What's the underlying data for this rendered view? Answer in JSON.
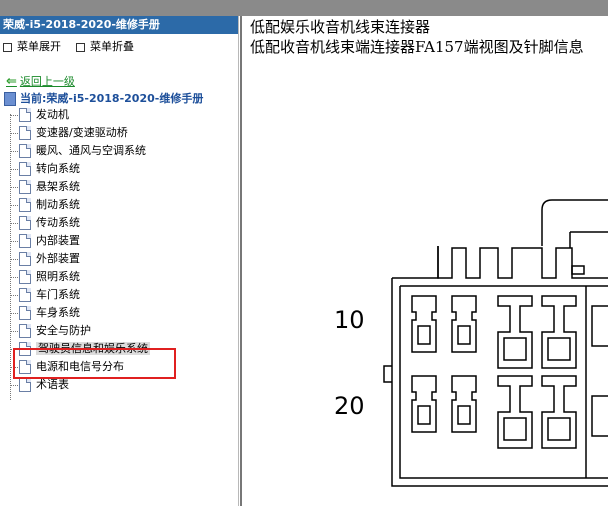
{
  "sidebar": {
    "title": "荣威-i5-2018-2020-维修手册",
    "expand_label": "菜单展开",
    "collapse_label": "菜单折叠",
    "back_label": "返回上一级",
    "current_label": "当前:荣威-i5-2018-2020-维修手册",
    "items": [
      {
        "label": "发动机"
      },
      {
        "label": "变速器/变速驱动桥"
      },
      {
        "label": "暖风、通风与空调系统"
      },
      {
        "label": "转向系统"
      },
      {
        "label": "悬架系统"
      },
      {
        "label": "制动系统"
      },
      {
        "label": "传动系统"
      },
      {
        "label": "内部装置"
      },
      {
        "label": "外部装置"
      },
      {
        "label": "照明系统"
      },
      {
        "label": "车门系统"
      },
      {
        "label": "车身系统"
      },
      {
        "label": "安全与防护"
      },
      {
        "label": "驾驶员信息和娱乐系统",
        "selected": true
      },
      {
        "label": "电源和电信号分布"
      },
      {
        "label": "术语表"
      }
    ]
  },
  "content": {
    "title_line1": "低配娱乐收音机线束连接器",
    "title_line2": "低配收音机线束端连接器FA157端视图及针脚信息",
    "pin_label_10": "10",
    "pin_label_20": "20"
  },
  "colors": {
    "header_bg": "#2c6aa8",
    "link_green": "#1a8a2a",
    "highlight_red": "#e02020"
  }
}
